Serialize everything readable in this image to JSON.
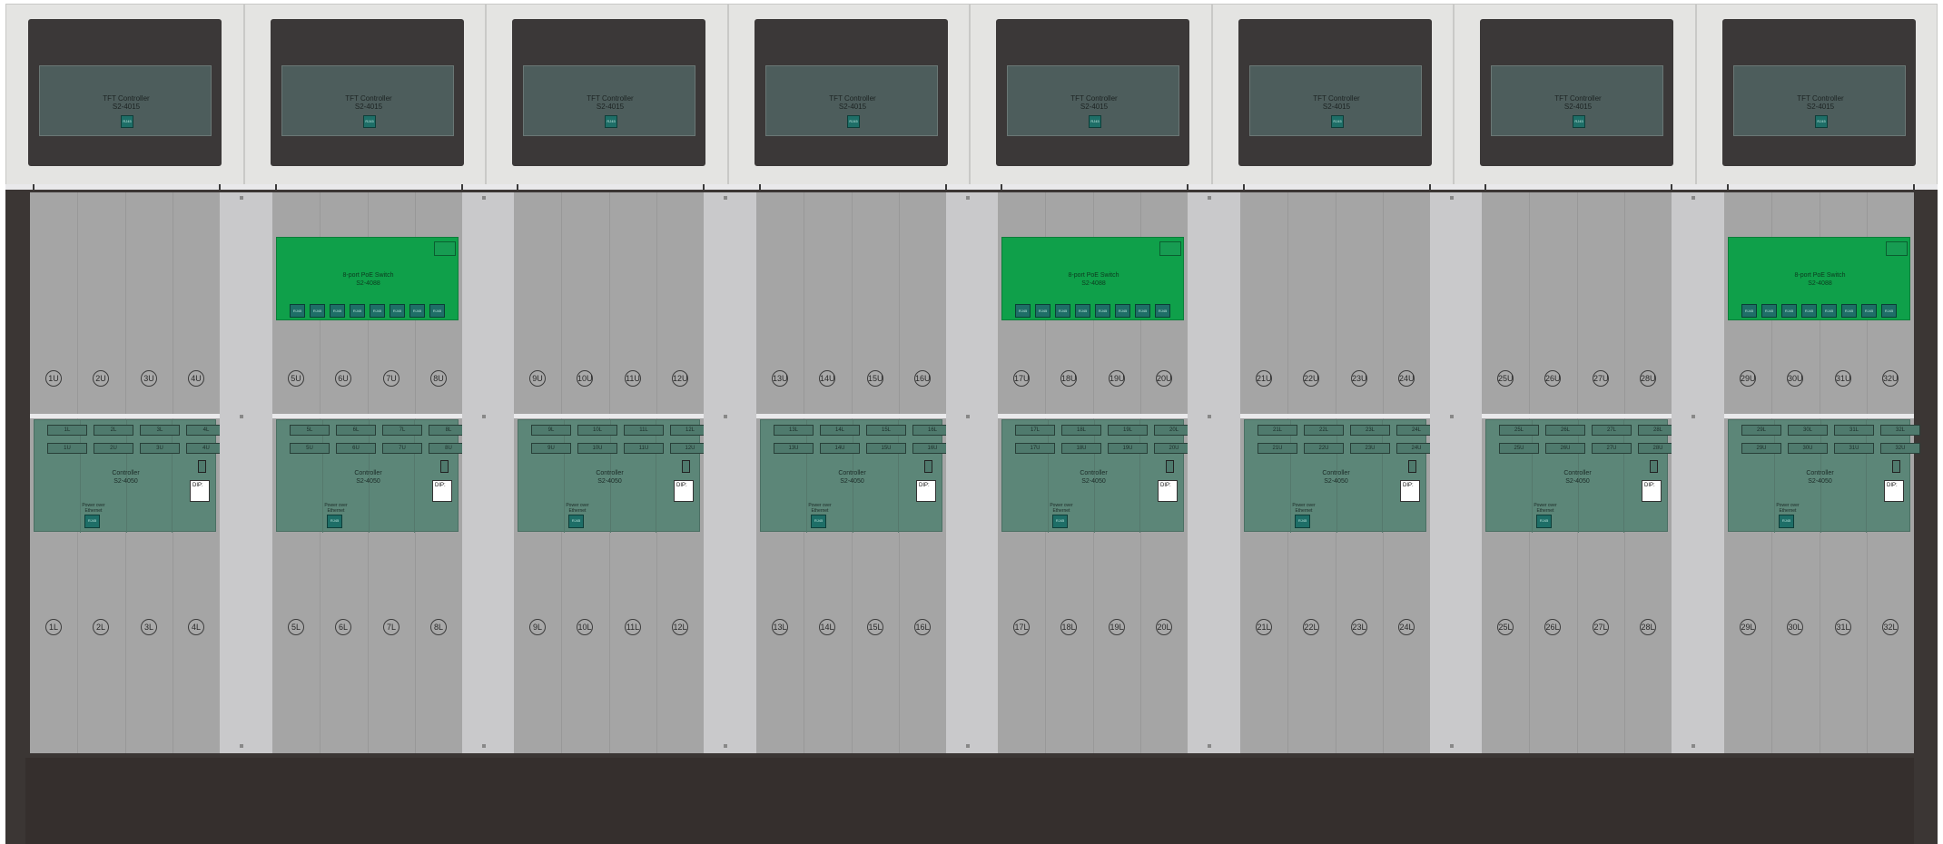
{
  "tft": {
    "title": "TFT Controller",
    "model": "S2-4015",
    "port": "RJ45"
  },
  "switch": {
    "title": "8-port PoE Switch",
    "model": "S2-4088",
    "port": "RJ45"
  },
  "controller": {
    "title": "Controller",
    "model": "S2-4050",
    "poe_line1": "Power over",
    "poe_line2": "Ethernet",
    "port": "RJ45",
    "dip_label": "DIP:"
  },
  "bays": [
    {
      "upper": [
        "1U",
        "2U",
        "3U",
        "4U"
      ],
      "lower": [
        "1L",
        "2L",
        "3L",
        "4L"
      ],
      "has_switch": false
    },
    {
      "upper": [
        "5U",
        "6U",
        "7U",
        "8U"
      ],
      "lower": [
        "5L",
        "6L",
        "7L",
        "8L"
      ],
      "has_switch": true
    },
    {
      "upper": [
        "9U",
        "10U",
        "11U",
        "12U"
      ],
      "lower": [
        "9L",
        "10L",
        "11L",
        "12L"
      ],
      "has_switch": false
    },
    {
      "upper": [
        "13U",
        "14U",
        "15U",
        "16U"
      ],
      "lower": [
        "13L",
        "14L",
        "15L",
        "16L"
      ],
      "has_switch": false
    },
    {
      "upper": [
        "17U",
        "18U",
        "19U",
        "20U"
      ],
      "lower": [
        "17L",
        "18L",
        "19L",
        "20L"
      ],
      "has_switch": true
    },
    {
      "upper": [
        "21U",
        "22U",
        "23U",
        "24U"
      ],
      "lower": [
        "21L",
        "22L",
        "23L",
        "24L"
      ],
      "has_switch": false
    },
    {
      "upper": [
        "25U",
        "26U",
        "27U",
        "28U"
      ],
      "lower": [
        "25L",
        "26L",
        "27L",
        "28L"
      ],
      "has_switch": false
    },
    {
      "upper": [
        "29U",
        "30U",
        "31U",
        "32U"
      ],
      "lower": [
        "29L",
        "30L",
        "31L",
        "32L"
      ],
      "has_switch": true
    }
  ],
  "colors": {
    "switch": "#0fa04a",
    "controller": "#5c8678",
    "tft_screen": "#4d5d5c",
    "cabinet": "#3b3634"
  }
}
